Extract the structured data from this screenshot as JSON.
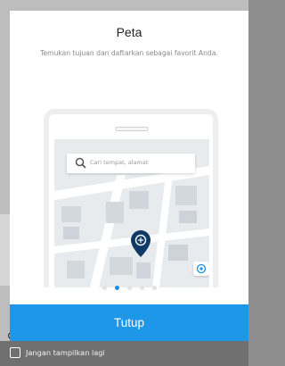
{
  "dialog": {
    "title": "Peta",
    "subtitle": "Temukan tujuan dan daftarkan sebagai favorit Anda.",
    "illustration": {
      "search_placeholder": "Cari tempat, alamat",
      "pin_color": "#0d3b66",
      "search_icon": "search-icon",
      "pin_icon": "location-pin-icon",
      "badge_icon": "favorite-place-icon"
    },
    "pager": {
      "total": 5,
      "active_index": 1,
      "active_color": "#1a8fe3"
    },
    "close_label": "Tutup",
    "accent_color": "#1e97e8"
  },
  "footer": {
    "dont_show_label": "Jangan tampilkan lagi",
    "checked": false
  }
}
